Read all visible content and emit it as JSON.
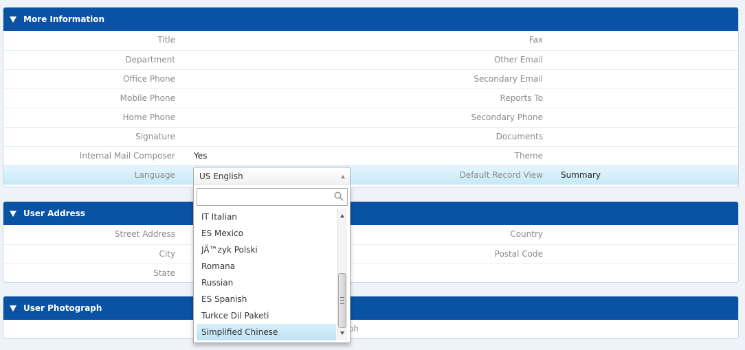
{
  "more_info": {
    "header": "More Information",
    "rows": [
      {
        "left_label": "Title",
        "left_value": "",
        "right_label": "Fax",
        "right_value": ""
      },
      {
        "left_label": "Department",
        "left_value": "",
        "right_label": "Other Email",
        "right_value": ""
      },
      {
        "left_label": "Office Phone",
        "left_value": "",
        "right_label": "Secondary Email",
        "right_value": ""
      },
      {
        "left_label": "Mobile Phone",
        "left_value": "",
        "right_label": "Reports To",
        "right_value": ""
      },
      {
        "left_label": "Home Phone",
        "left_value": "",
        "right_label": "Secondary Phone",
        "right_value": ""
      },
      {
        "left_label": "Signature",
        "left_value": "",
        "right_label": "Documents",
        "right_value": ""
      },
      {
        "left_label": "Internal Mail Composer",
        "left_value": "Yes",
        "right_label": "Theme",
        "right_value": ""
      },
      {
        "left_label": "Language",
        "left_value": "",
        "right_label": "Default Record View",
        "right_value": "Summary"
      }
    ]
  },
  "user_address": {
    "header": "User Address",
    "rows": [
      {
        "left_label": "Street Address",
        "right_label": "Country"
      },
      {
        "left_label": "City",
        "right_label": "Postal Code"
      },
      {
        "left_label": "State",
        "right_label": ""
      }
    ]
  },
  "user_photo": {
    "header": "User Photograph",
    "label": "ph"
  },
  "language_select": {
    "selected": "US English",
    "search_value": "",
    "options": [
      "IT Italian",
      "ES Mexico",
      "JÄ™zyk Polski",
      "Romana",
      "Russian",
      "ES Spanish",
      "Turkce Dil Paketi",
      "Simplified Chinese"
    ],
    "highlighted": "Simplified Chinese"
  },
  "colors": {
    "header_bg": "#0a52a3",
    "highlight_row": "#c6e9f7",
    "label_text": "#8a8a8a"
  }
}
